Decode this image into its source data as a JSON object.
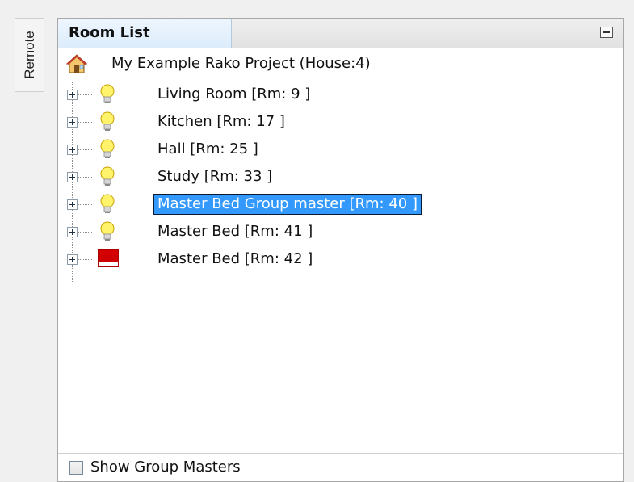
{
  "sidebar": {
    "tab_label": "Remote"
  },
  "panel": {
    "tab_label": "Room List",
    "minimize_icon": "minimize-icon"
  },
  "tree": {
    "root": {
      "label": "My Example Rako Project (House:4)",
      "icon": "house-icon"
    },
    "rooms": [
      {
        "label": "Living Room [Rm: 9 ]",
        "icon": "bulb-icon",
        "selected": false
      },
      {
        "label": "Kitchen  [Rm: 17 ]",
        "icon": "bulb-icon",
        "selected": false
      },
      {
        "label": "Hall  [Rm: 25 ]",
        "icon": "bulb-icon",
        "selected": false
      },
      {
        "label": "Study  [Rm: 33 ]",
        "icon": "bulb-icon",
        "selected": false
      },
      {
        "label": "Master Bed Group master [Rm: 40 ]",
        "icon": "bulb-icon",
        "selected": true
      },
      {
        "label": "Master Bed [Rm: 41 ]",
        "icon": "bulb-icon",
        "selected": false
      },
      {
        "label": "Master Bed [Rm: 42 ]",
        "icon": "red-group-icon",
        "selected": false
      }
    ]
  },
  "footer": {
    "checkbox_label": "Show Group Masters",
    "checked": false
  },
  "colors": {
    "selection": "#3399ff",
    "tab_highlight": "#dcecfb"
  }
}
